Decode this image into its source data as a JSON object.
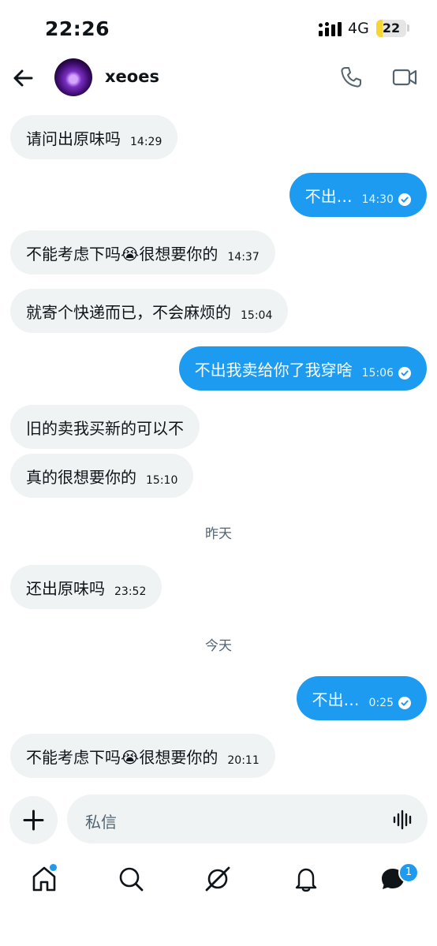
{
  "status_bar": {
    "time": "22:26",
    "network": "4G",
    "battery": "22",
    "battery_level": 0.22
  },
  "header": {
    "contact_name": "xeoes"
  },
  "messages": [
    {
      "dir": "in",
      "text": "请问出原味吗",
      "time": "14:29"
    },
    {
      "dir": "out",
      "text": "不出…",
      "time": "14:30"
    },
    {
      "dir": "in",
      "text": "不能考虑下吗😭很想要你的",
      "time": "14:37"
    },
    {
      "dir": "in",
      "text": "就寄个快递而已，不会麻烦的",
      "time": "15:04"
    },
    {
      "dir": "out",
      "text": "不出我卖给你了我穿啥",
      "time": "15:06"
    },
    {
      "dir": "in",
      "text": "旧的卖我买新的可以不",
      "time": ""
    },
    {
      "dir": "in",
      "text": "真的很想要你的",
      "time": "15:10"
    },
    {
      "dir": "in",
      "text": "还出原味吗",
      "time": "23:52"
    },
    {
      "dir": "out",
      "text": "不出…",
      "time": "0:25"
    },
    {
      "dir": "in",
      "text": "不能考虑下吗😭很想要你的",
      "time": "20:11"
    }
  ],
  "separators": {
    "yesterday": "昨天",
    "today": "今天"
  },
  "composer": {
    "placeholder": "私信"
  },
  "tabbar": {
    "messages_badge": "1"
  },
  "colors": {
    "accent": "#1d9bf0",
    "incoming_bubble": "#eff3f4",
    "battery": "#f7d533"
  },
  "icons": [
    "back-arrow-icon",
    "phone-icon",
    "video-camera-icon",
    "plus-icon",
    "voice-wave-icon",
    "home-icon",
    "search-icon",
    "grok-icon",
    "bell-icon",
    "messages-icon",
    "checkmark-icon"
  ]
}
